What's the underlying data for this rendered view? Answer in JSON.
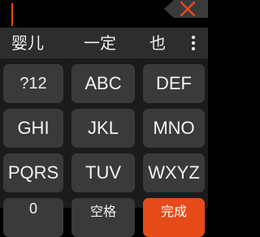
{
  "keyboard": {
    "candidates": [
      "婴儿",
      "一定",
      "也"
    ],
    "rows": [
      [
        "?12",
        "ABC",
        "DEF"
      ],
      [
        "GHI",
        "JKL",
        "MNO"
      ],
      [
        "PQRS",
        "TUV",
        "WXYZ"
      ]
    ],
    "bottom": {
      "zero": "0",
      "space": "空格",
      "done": "完成"
    },
    "colors": {
      "accent": "#e64a19",
      "key": "#3a3a3a",
      "candidate_bar": "#2d2d2d"
    },
    "icons": {
      "delete": "close-icon",
      "more": "more-vertical-icon"
    }
  }
}
